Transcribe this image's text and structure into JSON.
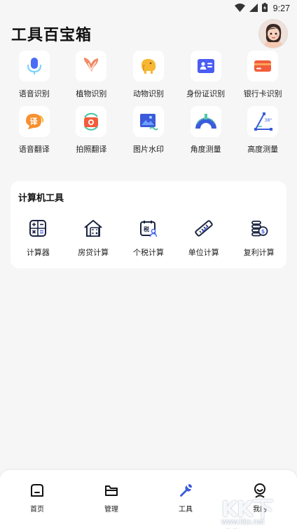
{
  "status": {
    "time": "9:27"
  },
  "header": {
    "title": "工具百宝箱"
  },
  "tools": [
    {
      "label": "语音识别",
      "icon": "microphone-icon"
    },
    {
      "label": "植物识别",
      "icon": "plant-icon"
    },
    {
      "label": "动物识别",
      "icon": "elephant-icon"
    },
    {
      "label": "身份证识别",
      "icon": "id-card-icon"
    },
    {
      "label": "银行卡识别",
      "icon": "bank-card-icon"
    },
    {
      "label": "语音翻译",
      "icon": "translate-bubble-icon",
      "glyph": "译"
    },
    {
      "label": "拍照翻译",
      "icon": "camera-translate-icon"
    },
    {
      "label": "图片水印",
      "icon": "image-watermark-icon"
    },
    {
      "label": "角度测量",
      "icon": "protractor-icon"
    },
    {
      "label": "高度测量",
      "icon": "height-measure-icon",
      "glyph": "38°"
    }
  ],
  "calculator_section": {
    "title": "计算机工具",
    "items": [
      {
        "label": "计算器",
        "icon": "calculator-icon"
      },
      {
        "label": "房贷计算",
        "icon": "house-calculator-icon"
      },
      {
        "label": "个税计算",
        "icon": "tax-calendar-icon",
        "glyph": "税"
      },
      {
        "label": "单位计算",
        "icon": "ruler-icon"
      },
      {
        "label": "复利计算",
        "icon": "coins-icon",
        "glyph": "$"
      }
    ]
  },
  "tabbar": {
    "items": [
      {
        "label": "首页",
        "icon": "home-icon"
      },
      {
        "label": "管理",
        "icon": "folder-icon"
      },
      {
        "label": "工具",
        "icon": "wrench-icon",
        "active": true
      },
      {
        "label": "我的",
        "icon": "user-icon"
      }
    ]
  },
  "watermark": {
    "brand": "KK下载",
    "url": "www.kkx.net"
  },
  "colors": {
    "background": "#f6f6f6",
    "accent_blue": "#3b5bdb",
    "mic_blue": "#4a6cf7",
    "plant_orange": "#f07a50",
    "elephant_yellow": "#f7b733",
    "card_red": "#f25c3c"
  }
}
